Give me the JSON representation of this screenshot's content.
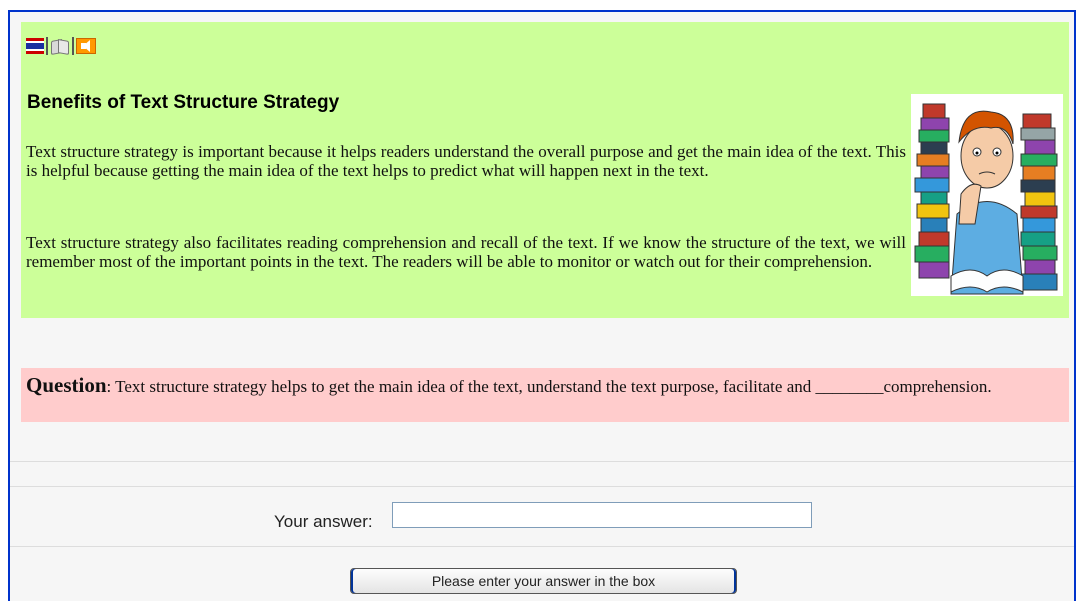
{
  "icons": {
    "flag": "flag-icon",
    "book": "book-icon",
    "audio": "speaker-icon"
  },
  "content": {
    "title": "Benefits of Text Structure Strategy",
    "paragraph1": "Text structure strategy is important because it helps readers understand the overall purpose and get the main idea of the text. This is helpful because getting the main idea of the text helps to predict what will happen next in the text.",
    "paragraph2": "Text structure strategy also facilitates reading comprehension and recall of the text. If we know the structure of the text, we will remember most of the important points in the text. The readers will be able to monitor or watch out for their comprehension.",
    "image": "student-reading-illustration"
  },
  "question": {
    "label": "Question",
    "text": ": Text structure strategy helps to get the main idea of the text, understand the text purpose, facilitate and ________comprehension."
  },
  "answer": {
    "label": "Your answer:",
    "value": "",
    "button_label": "Please enter your answer in the box"
  },
  "colors": {
    "panel_green": "#ccff99",
    "question_pink": "#ffcccc",
    "frame_blue": "#0033cc"
  }
}
